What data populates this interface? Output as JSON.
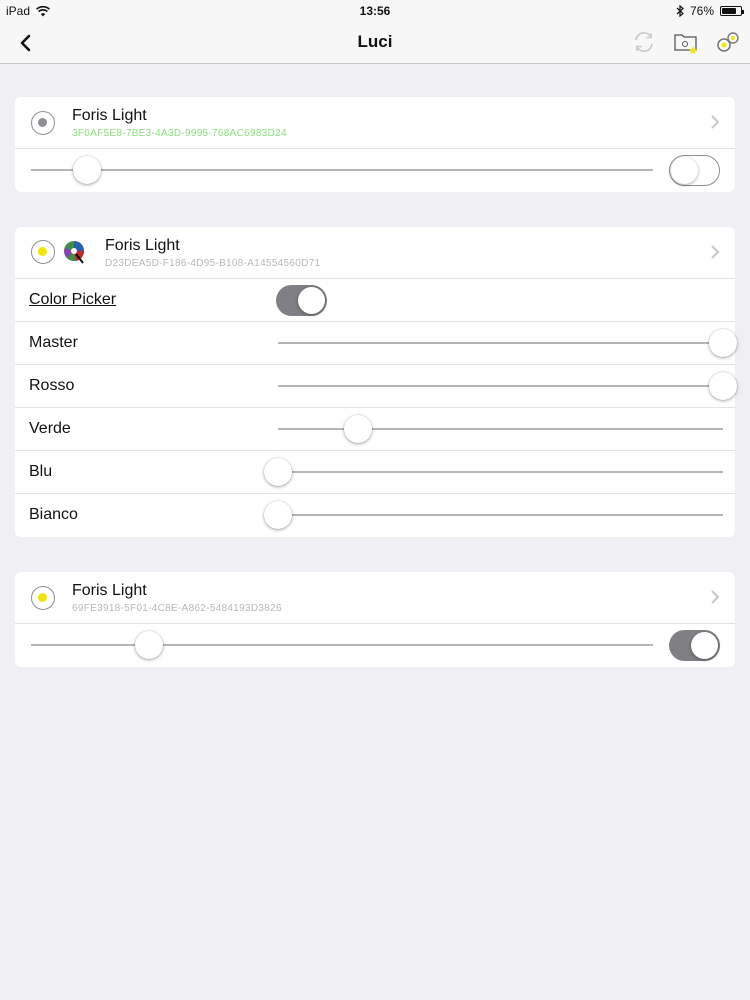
{
  "status_bar": {
    "device": "iPad",
    "time": "13:56",
    "battery": "76%",
    "battery_level": 0.76,
    "icons": [
      "wifi-icon",
      "bluetooth-icon",
      "battery-icon"
    ]
  },
  "navbar": {
    "title": "Luci",
    "icons": [
      "back-chevron-icon",
      "sync-icon",
      "folder-icon",
      "settings-icon"
    ]
  },
  "lights": [
    {
      "name": "Foris Light",
      "uuid": "3F0AF5E8-7BE3-4A3D-9995-768AC6983D24",
      "uuid_color": "#86e07a",
      "radio_dot_color": "#8e8e93",
      "level": 0.09,
      "power_on": false
    },
    {
      "name": "Foris Light",
      "uuid": "D23DEA5D-F186-4D95-B108-A14554560D71",
      "uuid_color": "#b8b8bc",
      "radio_dot_color": "#f2e600",
      "color_picker_label": "Color Picker",
      "color_picker_on": true,
      "channels": [
        {
          "label": "Master",
          "level": 1.0
        },
        {
          "label": "Rosso",
          "level": 1.0
        },
        {
          "label": "Verde",
          "level": 0.18
        },
        {
          "label": "Blu",
          "level": 0.0
        },
        {
          "label": "Bianco",
          "level": 0.0
        }
      ]
    },
    {
      "name": "Foris Light",
      "uuid": "69FE3918-5F01-4C8E-A862-5484193D3826",
      "uuid_color": "#b8b8bc",
      "radio_dot_color": "#f2e600",
      "level": 0.19,
      "power_on": true
    }
  ]
}
